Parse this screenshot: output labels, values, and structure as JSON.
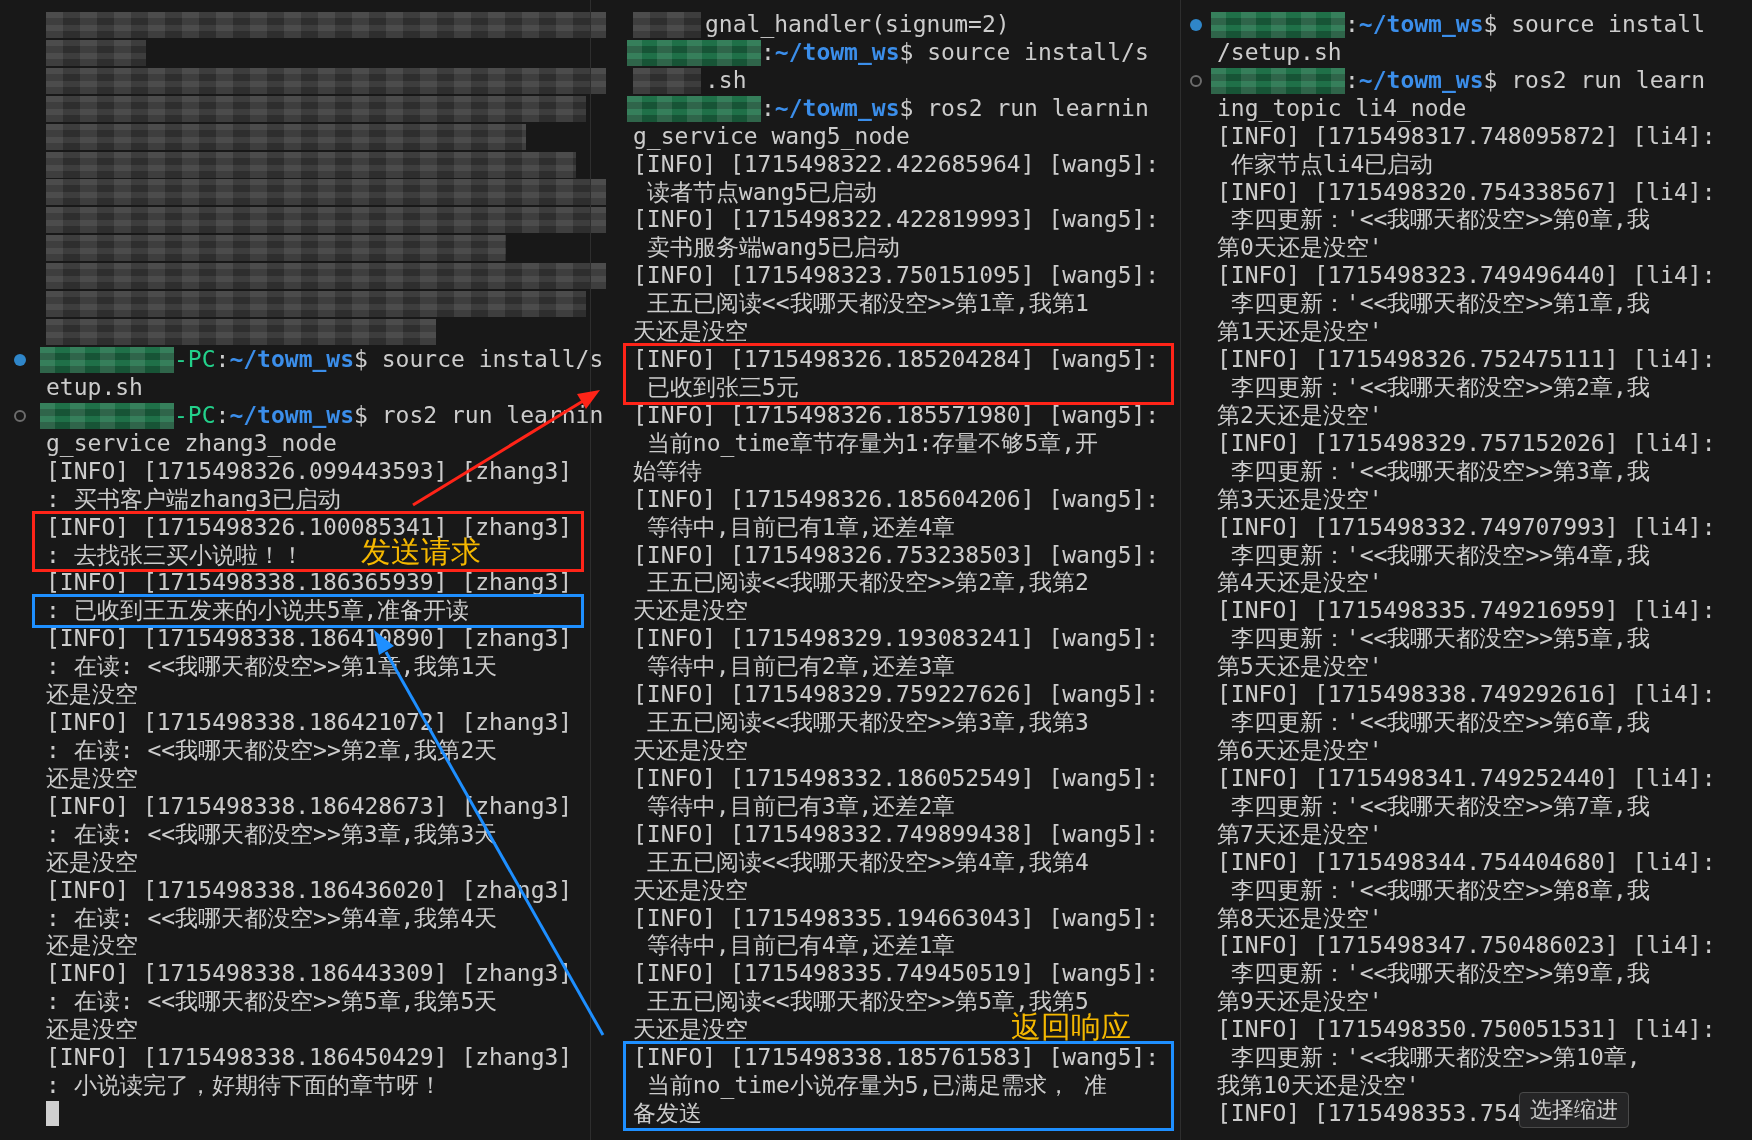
{
  "panes": [
    {
      "lines": [
        {
          "kind": "mosaic"
        },
        {
          "kind": "mosaic"
        },
        {
          "kind": "mosaic"
        },
        {
          "kind": "mosaic"
        },
        {
          "kind": "mosaic"
        },
        {
          "kind": "mosaic"
        },
        {
          "kind": "mosaic"
        },
        {
          "kind": "mosaic"
        },
        {
          "kind": "mosaic"
        },
        {
          "kind": "mosaic"
        },
        {
          "kind": "mosaic"
        },
        {
          "kind": "mosaic"
        },
        {
          "kind": "prompt",
          "running": false,
          "host": "-PC",
          "colon": ":",
          "path": "~/towm_ws",
          "sign": "$",
          "command": " source install/s"
        },
        {
          "kind": "text",
          "text": "etup.sh"
        },
        {
          "kind": "prompt",
          "running": true,
          "host": "-PC",
          "colon": ":",
          "path": "~/towm_ws",
          "sign": "$",
          "command": " ros2 run learnin"
        },
        {
          "kind": "text",
          "text": "g_service zhang3_node"
        },
        {
          "kind": "text",
          "text": "[INFO] [1715498326.099443593] [zhang3]"
        },
        {
          "kind": "text",
          "text": ": 买书客户端zhang3已启动"
        },
        {
          "kind": "box",
          "color": "#ff2418",
          "label": "发送请求",
          "lines": [
            {
              "kind": "text",
              "text": "[INFO] [1715498326.100085341] [zhang3]"
            },
            {
              "kind": "text",
              "text": ": 去找张三买小说啦！！"
            }
          ]
        },
        {
          "kind": "text",
          "text": "[INFO] [1715498338.186365939] [zhang3]"
        },
        {
          "kind": "box",
          "color": "#1e8fff",
          "lines": [
            {
              "kind": "text",
              "text": ": 已收到王五发来的小说共5章,准备开读"
            }
          ]
        },
        {
          "kind": "text",
          "text": "[INFO] [1715498338.186410890] [zhang3]"
        },
        {
          "kind": "text",
          "text": ": 在读: <<我哪天都没空>>第1章,我第1天"
        },
        {
          "kind": "text",
          "text": "还是没空"
        },
        {
          "kind": "text",
          "text": "[INFO] [1715498338.186421072] [zhang3]"
        },
        {
          "kind": "text",
          "text": ": 在读: <<我哪天都没空>>第2章,我第2天"
        },
        {
          "kind": "text",
          "text": "还是没空"
        },
        {
          "kind": "text",
          "text": "[INFO] [1715498338.186428673] [zhang3]"
        },
        {
          "kind": "text",
          "text": ": 在读: <<我哪天都没空>>第3章,我第3天"
        },
        {
          "kind": "text",
          "text": "还是没空"
        },
        {
          "kind": "text",
          "text": "[INFO] [1715498338.186436020] [zhang3]"
        },
        {
          "kind": "text",
          "text": ": 在读: <<我哪天都没空>>第4章,我第4天"
        },
        {
          "kind": "text",
          "text": "还是没空"
        },
        {
          "kind": "text",
          "text": "[INFO] [1715498338.186443309] [zhang3]"
        },
        {
          "kind": "text",
          "text": ": 在读: <<我哪天都没空>>第5章,我第5天"
        },
        {
          "kind": "text",
          "text": "还是没空"
        },
        {
          "kind": "text",
          "text": "[INFO] [1715498338.186450429] [zhang3]"
        },
        {
          "kind": "text",
          "text": ": 小说读完了，好期待下面的章节呀！"
        },
        {
          "kind": "cursor"
        }
      ]
    },
    {
      "lines": [
        {
          "kind": "masked",
          "text": "gnal_handler(signum=2)"
        },
        {
          "kind": "prompt",
          "colon": ":",
          "path": "~/towm_ws",
          "sign": "$",
          "command": " source install/s"
        },
        {
          "kind": "masked",
          "text": ".sh"
        },
        {
          "kind": "prompt",
          "colon": ":",
          "path": "~/towm_ws",
          "sign": "$",
          "command": " ros2 run learnin"
        },
        {
          "kind": "text",
          "text": "g_service wang5_node"
        },
        {
          "kind": "text",
          "text": "[INFO] [1715498322.422685964] [wang5]:"
        },
        {
          "kind": "text",
          "text": " 读者节点wang5已启动"
        },
        {
          "kind": "text",
          "text": "[INFO] [1715498322.422819993] [wang5]:"
        },
        {
          "kind": "text",
          "text": " 卖书服务端wang5已启动"
        },
        {
          "kind": "text",
          "text": "[INFO] [1715498323.750151095] [wang5]:"
        },
        {
          "kind": "text",
          "text": " 王五已阅读<<我哪天都没空>>第1章,我第1"
        },
        {
          "kind": "text",
          "text": "天还是没空"
        },
        {
          "kind": "box",
          "color": "#ff2418",
          "lines": [
            {
              "kind": "text",
              "text": "[INFO] [1715498326.185204284] [wang5]:"
            },
            {
              "kind": "text",
              "text": " 已收到张三5元"
            }
          ]
        },
        {
          "kind": "text",
          "text": "[INFO] [1715498326.185571980] [wang5]:"
        },
        {
          "kind": "text",
          "text": " 当前no_time章节存量为1:存量不够5章,开"
        },
        {
          "kind": "text",
          "text": "始等待"
        },
        {
          "kind": "text",
          "text": "[INFO] [1715498326.185604206] [wang5]:"
        },
        {
          "kind": "text",
          "text": " 等待中,目前已有1章,还差4章"
        },
        {
          "kind": "text",
          "text": "[INFO] [1715498326.753238503] [wang5]:"
        },
        {
          "kind": "text",
          "text": " 王五已阅读<<我哪天都没空>>第2章,我第2"
        },
        {
          "kind": "text",
          "text": "天还是没空"
        },
        {
          "kind": "text",
          "text": "[INFO] [1715498329.193083241] [wang5]:"
        },
        {
          "kind": "text",
          "text": " 等待中,目前已有2章,还差3章"
        },
        {
          "kind": "text",
          "text": "[INFO] [1715498329.759227626] [wang5]:"
        },
        {
          "kind": "text",
          "text": " 王五已阅读<<我哪天都没空>>第3章,我第3"
        },
        {
          "kind": "text",
          "text": "天还是没空"
        },
        {
          "kind": "text",
          "text": "[INFO] [1715498332.186052549] [wang5]:"
        },
        {
          "kind": "text",
          "text": " 等待中,目前已有3章,还差2章"
        },
        {
          "kind": "text",
          "text": "[INFO] [1715498332.749899438] [wang5]:"
        },
        {
          "kind": "text",
          "text": " 王五已阅读<<我哪天都没空>>第4章,我第4"
        },
        {
          "kind": "text",
          "text": "天还是没空"
        },
        {
          "kind": "text",
          "text": "[INFO] [1715498335.194663043] [wang5]:"
        },
        {
          "kind": "text",
          "text": " 等待中,目前已有4章,还差1章"
        },
        {
          "kind": "text",
          "text": "[INFO] [1715498335.749450519] [wang5]:"
        },
        {
          "kind": "text",
          "text": " 王五已阅读<<我哪天都没空>>第5章,我第5"
        },
        {
          "kind": "text",
          "text": "天还是没空"
        },
        {
          "kind": "box",
          "color": "#1e8fff",
          "label_above": "返回响应",
          "lines": [
            {
              "kind": "text",
              "text": "[INFO] [1715498338.185761583] [wang5]:"
            },
            {
              "kind": "text",
              "text": " 当前no_time小说存量为5,已满足需求， 准"
            },
            {
              "kind": "text",
              "text": "备发送"
            }
          ]
        }
      ]
    },
    {
      "tooltip": "选择缩进",
      "lines": [
        {
          "kind": "prompt",
          "running": false,
          "colon": ":",
          "path": "~/towm_ws",
          "sign": "$",
          "command": " source install"
        },
        {
          "kind": "text",
          "text": "/setup.sh"
        },
        {
          "kind": "prompt",
          "running": true,
          "colon": ":",
          "path": "~/towm_ws",
          "sign": "$",
          "command": " ros2 run learn"
        },
        {
          "kind": "text",
          "text": "ing_topic li4_node"
        },
        {
          "kind": "text",
          "text": "[INFO] [1715498317.748095872] [li4]:"
        },
        {
          "kind": "text",
          "text": " 作家节点li4已启动"
        },
        {
          "kind": "text",
          "text": "[INFO] [1715498320.754338567] [li4]:"
        },
        {
          "kind": "text",
          "text": " 李四更新：'<<我哪天都没空>>第0章,我"
        },
        {
          "kind": "text",
          "text": "第0天还是没空'"
        },
        {
          "kind": "text",
          "text": "[INFO] [1715498323.749496440] [li4]:"
        },
        {
          "kind": "text",
          "text": " 李四更新：'<<我哪天都没空>>第1章,我"
        },
        {
          "kind": "text",
          "text": "第1天还是没空'"
        },
        {
          "kind": "text",
          "text": "[INFO] [1715498326.752475111] [li4]:"
        },
        {
          "kind": "text",
          "text": " 李四更新：'<<我哪天都没空>>第2章,我"
        },
        {
          "kind": "text",
          "text": "第2天还是没空'"
        },
        {
          "kind": "text",
          "text": "[INFO] [1715498329.757152026] [li4]:"
        },
        {
          "kind": "text",
          "text": " 李四更新：'<<我哪天都没空>>第3章,我"
        },
        {
          "kind": "text",
          "text": "第3天还是没空'"
        },
        {
          "kind": "text",
          "text": "[INFO] [1715498332.749707993] [li4]:"
        },
        {
          "kind": "text",
          "text": " 李四更新：'<<我哪天都没空>>第4章,我"
        },
        {
          "kind": "text",
          "text": "第4天还是没空'"
        },
        {
          "kind": "text",
          "text": "[INFO] [1715498335.749216959] [li4]:"
        },
        {
          "kind": "text",
          "text": " 李四更新：'<<我哪天都没空>>第5章,我"
        },
        {
          "kind": "text",
          "text": "第5天还是没空'"
        },
        {
          "kind": "text",
          "text": "[INFO] [1715498338.749292616] [li4]:"
        },
        {
          "kind": "text",
          "text": " 李四更新：'<<我哪天都没空>>第6章,我"
        },
        {
          "kind": "text",
          "text": "第6天还是没空'"
        },
        {
          "kind": "text",
          "text": "[INFO] [1715498341.749252440] [li4]:"
        },
        {
          "kind": "text",
          "text": " 李四更新：'<<我哪天都没空>>第7章,我"
        },
        {
          "kind": "text",
          "text": "第7天还是没空'"
        },
        {
          "kind": "text",
          "text": "[INFO] [1715498344.754404680] [li4]:"
        },
        {
          "kind": "text",
          "text": " 李四更新：'<<我哪天都没空>>第8章,我"
        },
        {
          "kind": "text",
          "text": "第8天还是没空'"
        },
        {
          "kind": "text",
          "text": "[INFO] [1715498347.750486023] [li4]:"
        },
        {
          "kind": "text",
          "text": " 李四更新：'<<我哪天都没空>>第9章,我"
        },
        {
          "kind": "text",
          "text": "第9天还是没空'"
        },
        {
          "kind": "text",
          "text": "[INFO] [1715498350.750051531] [li4]:"
        },
        {
          "kind": "text",
          "text": " 李四更新：'<<我哪天都没空>>第10章,"
        },
        {
          "kind": "text",
          "text": "我第10天还是没空'"
        },
        {
          "kind": "text",
          "text": "[INFO] [1715498353.754"
        }
      ]
    }
  ]
}
